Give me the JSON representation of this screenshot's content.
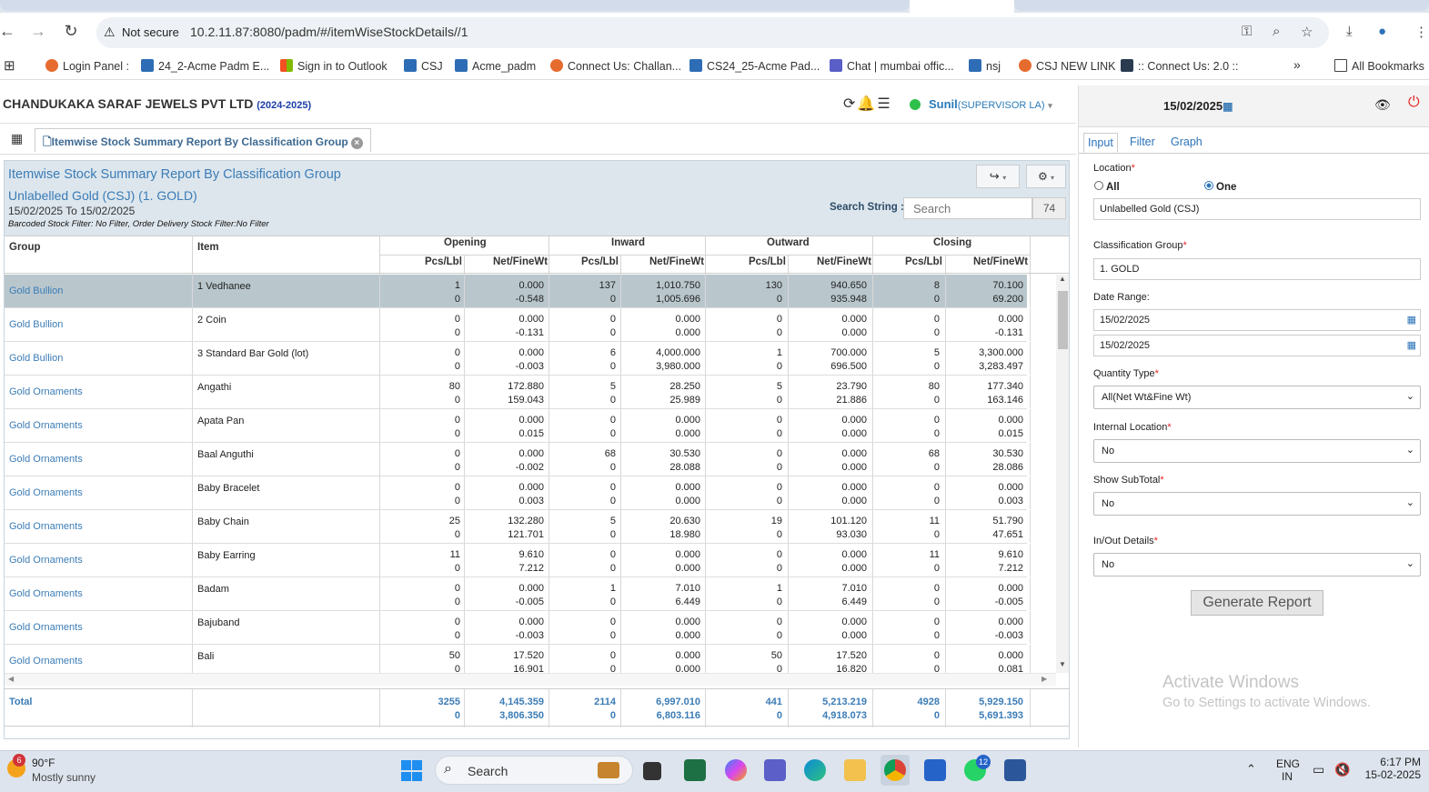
{
  "browser": {
    "nav": {
      "back": "←",
      "forward": "→",
      "reload": "↻"
    },
    "security_label": "Not secure",
    "url": "10.2.11.87:8080/padm/#/itemWiseStockDetails//1",
    "bookmarks": [
      "Login Panel :",
      "24_2-Acme Padm E...",
      "Sign in to Outlook",
      "CSJ",
      "Acme_padm",
      "Connect Us: Challan...",
      "CS24_25-Acme Pad...",
      "Chat | mumbai offic...",
      "nsj",
      "CSJ NEW LINK",
      ":: Connect Us: 2.0 ::"
    ],
    "bookmarks_more": "»",
    "all_bookmarks": "All Bookmarks"
  },
  "app": {
    "company": "CHANDUKAKA SARAF JEWELS PVT LTD",
    "year": "(2024-2025)",
    "user": "Sunil",
    "role": "(SUPERVISOR LA)",
    "tab_label": "Itemwise Stock Summary Report By Classification Group",
    "icons": [
      "sync-icon",
      "bell-icon",
      "list-icon"
    ]
  },
  "report": {
    "title": "Itemwise Stock Summary Report By Classification Group",
    "subtitle": "Unlabelled Gold (CSJ) (1. GOLD)",
    "date_range": "15/02/2025 To 15/02/2025",
    "filter_note": "Barcoded Stock Filter: No Filter, Order Delivery Stock Filter:No Filter",
    "search_label": "Search String :",
    "search_placeholder": "Search",
    "record_count": "74",
    "columns": {
      "group": "Group",
      "item": "Item",
      "opening": "Opening",
      "inward": "Inward",
      "outward": "Outward",
      "closing": "Closing",
      "pcs": "Pcs/Lbl",
      "net": "Net/FineWt"
    },
    "rows": [
      {
        "group": "Gold Bullion",
        "item": "1 Vedhanee",
        "v": [
          "1",
          "0.000",
          "137",
          "1,010.750",
          "130",
          "940.650",
          "8",
          "70.100"
        ],
        "w": [
          "0",
          "-0.548",
          "0",
          "1,005.696",
          "0",
          "935.948",
          "0",
          "69.200"
        ]
      },
      {
        "group": "Gold Bullion",
        "item": "2 Coin",
        "v": [
          "0",
          "0.000",
          "0",
          "0.000",
          "0",
          "0.000",
          "0",
          "0.000"
        ],
        "w": [
          "0",
          "-0.131",
          "0",
          "0.000",
          "0",
          "0.000",
          "0",
          "-0.131"
        ]
      },
      {
        "group": "Gold Bullion",
        "item": "3 Standard Bar Gold (lot)",
        "v": [
          "0",
          "0.000",
          "6",
          "4,000.000",
          "1",
          "700.000",
          "5",
          "3,300.000"
        ],
        "w": [
          "0",
          "-0.003",
          "0",
          "3,980.000",
          "0",
          "696.500",
          "0",
          "3,283.497"
        ]
      },
      {
        "group": "Gold Ornaments",
        "item": "Angathi",
        "v": [
          "80",
          "172.880",
          "5",
          "28.250",
          "5",
          "23.790",
          "80",
          "177.340"
        ],
        "w": [
          "0",
          "159.043",
          "0",
          "25.989",
          "0",
          "21.886",
          "0",
          "163.146"
        ]
      },
      {
        "group": "Gold Ornaments",
        "item": "Apata Pan",
        "v": [
          "0",
          "0.000",
          "0",
          "0.000",
          "0",
          "0.000",
          "0",
          "0.000"
        ],
        "w": [
          "0",
          "0.015",
          "0",
          "0.000",
          "0",
          "0.000",
          "0",
          "0.015"
        ]
      },
      {
        "group": "Gold Ornaments",
        "item": "Baal Anguthi",
        "v": [
          "0",
          "0.000",
          "68",
          "30.530",
          "0",
          "0.000",
          "68",
          "30.530"
        ],
        "w": [
          "0",
          "-0.002",
          "0",
          "28.088",
          "0",
          "0.000",
          "0",
          "28.086"
        ]
      },
      {
        "group": "Gold Ornaments",
        "item": "Baby Bracelet",
        "v": [
          "0",
          "0.000",
          "0",
          "0.000",
          "0",
          "0.000",
          "0",
          "0.000"
        ],
        "w": [
          "0",
          "0.003",
          "0",
          "0.000",
          "0",
          "0.000",
          "0",
          "0.003"
        ]
      },
      {
        "group": "Gold Ornaments",
        "item": "Baby Chain",
        "v": [
          "25",
          "132.280",
          "5",
          "20.630",
          "19",
          "101.120",
          "11",
          "51.790"
        ],
        "w": [
          "0",
          "121.701",
          "0",
          "18.980",
          "0",
          "93.030",
          "0",
          "47.651"
        ]
      },
      {
        "group": "Gold Ornaments",
        "item": "Baby Earring",
        "v": [
          "11",
          "9.610",
          "0",
          "0.000",
          "0",
          "0.000",
          "11",
          "9.610"
        ],
        "w": [
          "0",
          "7.212",
          "0",
          "0.000",
          "0",
          "0.000",
          "0",
          "7.212"
        ]
      },
      {
        "group": "Gold Ornaments",
        "item": "Badam",
        "v": [
          "0",
          "0.000",
          "1",
          "7.010",
          "1",
          "7.010",
          "0",
          "0.000"
        ],
        "w": [
          "0",
          "-0.005",
          "0",
          "6.449",
          "0",
          "6.449",
          "0",
          "-0.005"
        ]
      },
      {
        "group": "Gold Ornaments",
        "item": "Bajuband",
        "v": [
          "0",
          "0.000",
          "0",
          "0.000",
          "0",
          "0.000",
          "0",
          "0.000"
        ],
        "w": [
          "0",
          "-0.003",
          "0",
          "0.000",
          "0",
          "0.000",
          "0",
          "-0.003"
        ]
      },
      {
        "group": "Gold Ornaments",
        "item": "Bali",
        "v": [
          "50",
          "17.520",
          "0",
          "0.000",
          "50",
          "17.520",
          "0",
          "0.000"
        ],
        "w": [
          "0",
          "16.901",
          "0",
          "0.000",
          "0",
          "16.820",
          "0",
          "0.081"
        ]
      }
    ],
    "total": {
      "label": "Total",
      "v": [
        "3255",
        "4,145.359",
        "2114",
        "6,997.010",
        "441",
        "5,213.219",
        "4928",
        "5,929.150"
      ],
      "w": [
        "0",
        "3,806.350",
        "0",
        "6,803.116",
        "0",
        "4,918.073",
        "0",
        "5,691.393"
      ]
    }
  },
  "side": {
    "date": "15/02/2025",
    "tabs": [
      "Input",
      "Filter",
      "Graph"
    ],
    "location_label": "Location",
    "radio_all": "All",
    "radio_one": "One",
    "location_value": "Unlabelled Gold (CSJ)",
    "class_group_label": "Classification Group",
    "class_group_value": "1. GOLD",
    "date_range_label": "Date Range:",
    "date_from": "15/02/2025",
    "date_to": "15/02/2025",
    "qty_type_label": "Quantity Type",
    "qty_type_value": "All(Net Wt&Fine Wt)",
    "internal_loc_label": "Internal Location",
    "internal_loc_value": "No",
    "show_subtotal_label": "Show SubTotal",
    "show_subtotal_value": "No",
    "inout_label": "In/Out Details",
    "inout_value": "No",
    "generate_button": "Generate Report",
    "required_mark": "*"
  },
  "watermark": {
    "line1": "Activate Windows",
    "line2": "Go to Settings to activate Windows."
  },
  "taskbar": {
    "weather_temp": "90°F",
    "weather_cond": "Mostly sunny",
    "weather_badge": "6",
    "search_label": "Search",
    "teams_badge": "12",
    "lang1": "ENG",
    "lang2": "IN",
    "time": "6:17 PM",
    "date": "15-02-2025"
  }
}
